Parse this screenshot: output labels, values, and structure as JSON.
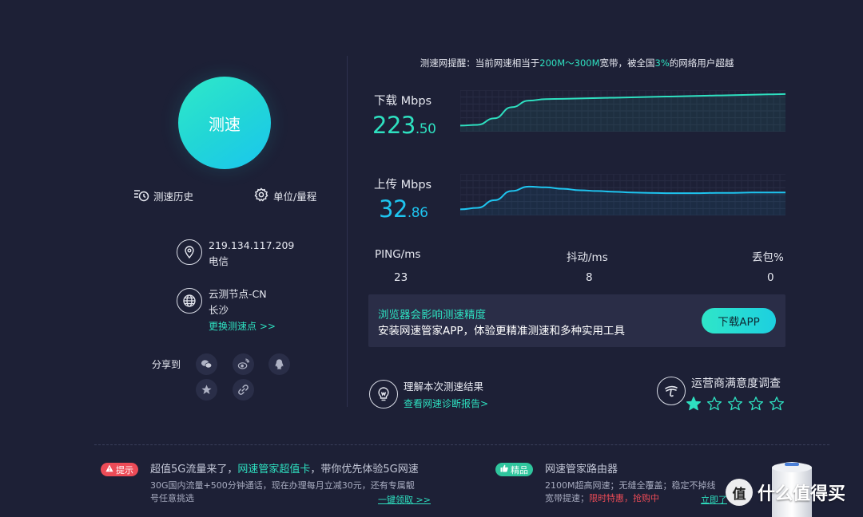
{
  "speed_test": {
    "button_label": "测速"
  },
  "tools": {
    "history_label": "测速历史",
    "units_label": "单位/量程"
  },
  "network": {
    "ip": "219.134.117.209",
    "isp": "电信"
  },
  "node": {
    "name": "云测节点-CN",
    "city": "长沙",
    "change_link": "更换测速点 >>"
  },
  "share": {
    "label": "分享到",
    "targets": [
      "wechat-icon",
      "weibo-icon",
      "qq-icon",
      "favorite-star-icon",
      "copy-link-icon"
    ]
  },
  "notice": {
    "prefix": "测速网提醒：当前网速相当于",
    "range": "200M～300M",
    "middle": "宽带，被全国",
    "percent": "3%",
    "suffix": "的网络用户超越"
  },
  "download": {
    "label": "下载 Mbps",
    "value_int": "223",
    "value_dec": ".50",
    "color": "#2ee0c0"
  },
  "upload": {
    "label": "上传 Mbps",
    "value_int": "32",
    "value_dec": ".86",
    "color": "#1ec4ef"
  },
  "chart_data": [
    {
      "type": "area",
      "series": [
        {
          "values": [
            0.1,
            0.12,
            0.3,
            0.6,
            0.78,
            0.82,
            0.83,
            0.84,
            0.85,
            0.86,
            0.87,
            0.88,
            0.89,
            0.9,
            0.91,
            0.92,
            0.93,
            0.94,
            0.95,
            0.96
          ]
        }
      ],
      "ylim": [
        0,
        1
      ],
      "grid": true
    },
    {
      "type": "area",
      "series": [
        {
          "values": [
            0.1,
            0.14,
            0.35,
            0.6,
            0.72,
            0.7,
            0.66,
            0.62,
            0.6,
            0.58,
            0.56,
            0.55,
            0.54,
            0.54,
            0.54,
            0.55,
            0.55,
            0.56,
            0.56,
            0.56
          ]
        }
      ],
      "ylim": [
        0,
        1
      ],
      "grid": true
    }
  ],
  "stats": {
    "ping_label": "PING/ms",
    "ping_value": "23",
    "jitter_label": "抖动/ms",
    "jitter_value": "8",
    "loss_label": "丢包%",
    "loss_value": "0"
  },
  "promo": {
    "title": "浏览器会影响测速精度",
    "subtitle": "安装网速管家APP，体验更精准测速和多种实用工具",
    "button": "下载APP"
  },
  "diagnosis": {
    "title": "理解本次测速结果",
    "link": "查看网速诊断报告>"
  },
  "survey": {
    "title": "运营商满意度调查",
    "rating": 1,
    "max": 5
  },
  "ad_left": {
    "tag": "提示",
    "title_a": "超值5G流量来了，",
    "title_b": "网速管家超值卡",
    "title_c": "，带你优先体验5G网速",
    "desc_line1": "30G国内流量+500分钟通话，现在办理每月立减30元，还有专属靓",
    "desc_line2": "号任意挑选",
    "link": "一键领取 >>"
  },
  "ad_right": {
    "tag": "精品",
    "title": "网速管家路由器",
    "desc_line1": "2100M超高网速；无缝全覆盖；稳定不掉线",
    "desc_line2_a": "宽带提速；",
    "desc_line2_b": "限时特惠，抢购中",
    "link": "立即了"
  },
  "watermark": {
    "logo": "值",
    "text": "什么值得买"
  },
  "colors": {
    "background": "#1d2036",
    "accent": "#2ee0c0",
    "upload": "#1ec4ef",
    "alert": "#ec4b57"
  }
}
